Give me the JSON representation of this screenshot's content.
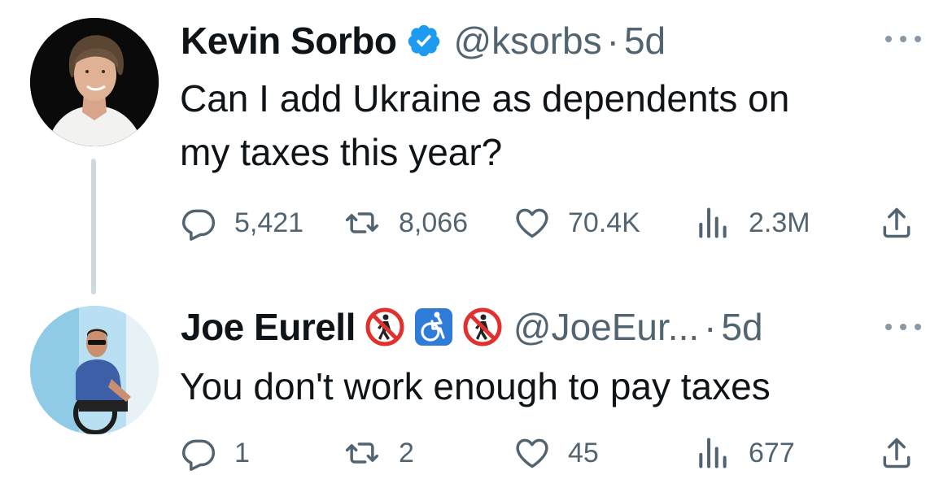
{
  "tweets": [
    {
      "display_name": "Kevin Sorbo",
      "verified": true,
      "handle": "@ksorbs",
      "separator": "·",
      "time": "5d",
      "text_lines": [
        "Can I add Ukraine as dependents on",
        "my taxes this year?"
      ],
      "replies": "5,421",
      "retweets": "8,066",
      "likes": "70.4K",
      "views": "2.3M",
      "badges": []
    },
    {
      "display_name": "Joe Eurell",
      "verified": false,
      "handle": "@JoeEur...",
      "separator": "·",
      "time": "5d",
      "text_lines": [
        "You don't work enough to pay taxes"
      ],
      "replies": "1",
      "retweets": "2",
      "likes": "45",
      "views": "677",
      "badges": [
        "no-pedestrians-icon",
        "wheelchair-icon",
        "no-pedestrians-icon"
      ]
    }
  ],
  "colors": {
    "text": "#0f1419",
    "secondary": "#536471",
    "verified_blue": "#1d9bf0",
    "thread_line": "#cfd9de"
  }
}
